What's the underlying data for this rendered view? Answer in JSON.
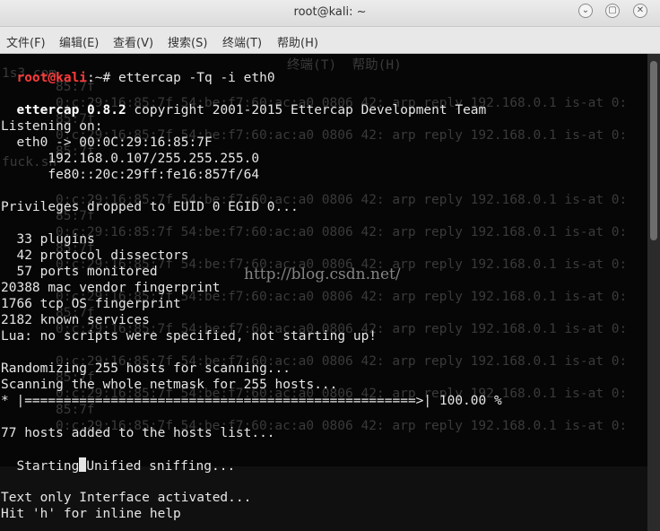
{
  "window": {
    "title": "root@kali: ~",
    "minimize_glyph": "⌄",
    "maximize_glyph": "▢",
    "close_glyph": "✕"
  },
  "menu": {
    "items": [
      "文件(F)",
      "编辑(E)",
      "查看(V)",
      "搜索(S)",
      "终端(T)",
      "帮助(H)"
    ]
  },
  "terminal": {
    "prompt_user": "root@kali",
    "prompt_rest": ":~# ettercap -Tq -i eth0",
    "banner_bold": "ettercap 0.8.2",
    "banner_rest": " copyright 2001-2015 Ettercap Development Team",
    "listening": "Listening on:",
    "iface_line": "  eth0 -> 00:0C:29:16:85:7F",
    "ipv4_line": "      192.168.0.107/255.255.255.0",
    "ipv6_line": "      fe80::20c:29ff:fe16:857f/64",
    "privileges": "Privileges dropped to EUID 0 EGID 0...",
    "plugins": "  33 plugins",
    "dissectors": "  42 protocol dissectors",
    "ports": "  57 ports monitored",
    "mac_vendor": "20388 mac vendor fingerprint",
    "tcp_os": "1766 tcp OS fingerprint",
    "services": "2182 known services",
    "lua": "Lua: no scripts were specified, not starting up!",
    "randomizing": "Randomizing 255 hosts for scanning...",
    "scanning": "Scanning the whole netmask for 255 hosts...",
    "progress_bar": "* |==================================================>| 100.00 %",
    "hosts_added": "77 hosts added to the hosts list...",
    "starting_prefix": "Starting",
    "starting_rest": "Unified sniffing...",
    "text_only": "Text only Interface activated...",
    "help_hint": "Hit 'h' for inline help"
  },
  "background_ghost": {
    "mac_fragment": "85:7f",
    "arp_line": "0:c:29:16:85:7f 54:be:f7:60:ac:a0 0806 42: arp reply 192.168.0.1 is-at 0:",
    "menu_fragment": "终端(T)  帮助(H)",
    "file_fragment": "fuck.sh",
    "num_fragment": "1s3.com"
  },
  "watermark": "http://blog.csdn.net/"
}
